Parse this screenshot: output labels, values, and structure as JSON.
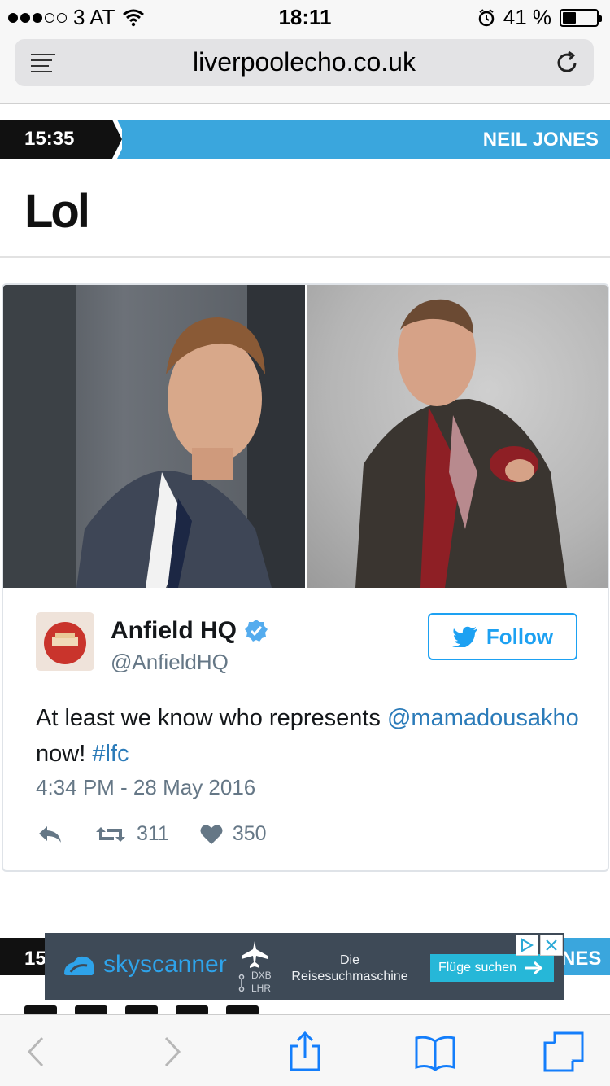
{
  "status_bar": {
    "carrier": "3 AT",
    "time": "18:11",
    "battery": "41 %",
    "battery_level": 0.41
  },
  "browser": {
    "url": "liverpoolecho.co.uk"
  },
  "post": {
    "time": "15:35",
    "author": "NEIL JONES",
    "headline": "Lol"
  },
  "tweet": {
    "name": "Anfield HQ",
    "handle": "@AnfieldHQ",
    "follow_label": "Follow",
    "text_before": "At least we know who represents ",
    "mention": "@mamadousakho",
    "text_middle": " now! ",
    "hashtag": "#lfc",
    "date": "4:34 PM - 28 May 2016",
    "retweets": "311",
    "likes": "350"
  },
  "next_post": {
    "time_partial": "15",
    "author_partial": "NES"
  },
  "ad": {
    "brand": "skyscanner",
    "route_from": "DXB",
    "route_to": "LHR",
    "description": "Die Reisesuchmaschine",
    "cta": "Flüge suchen"
  },
  "colors": {
    "accent_blue": "#3aa6dd",
    "twitter_blue": "#1da1f2",
    "link_blue": "#2b7bb9",
    "ad_bg": "#3e4a57"
  },
  "toolbar": {
    "icons": [
      "back-icon",
      "forward-icon",
      "share-icon",
      "bookmarks-icon",
      "tabs-icon"
    ]
  }
}
